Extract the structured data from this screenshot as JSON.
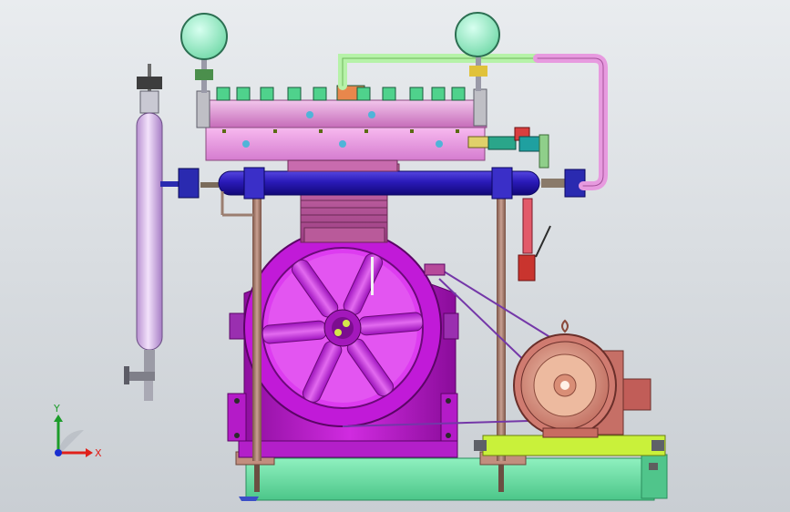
{
  "viewport": {
    "background_top": "#e9ecef",
    "background_bottom": "#c9ced3"
  },
  "triad": {
    "x_label": "X",
    "y_label": "Y",
    "x_color": "#e0201a",
    "y_color": "#1c9c2a",
    "z_color": "#1a2fd0"
  },
  "colors": {
    "base_plate": "#6fe0a6",
    "flywheel": "#d31ee8",
    "crankcase": "#c51fd6",
    "cylinder_head": "#e49ad6",
    "manifold": "#2a1ab8",
    "receiver": "#e6c7f2",
    "gauge": "#9af0c9",
    "motor": "#cf7a7a",
    "motor_face": "#e8b29a",
    "pipe_green": "#b6f2a8",
    "pipe_pink": "#e79adf",
    "rod": "#a87a6a",
    "motor_frame": "#c9f13a"
  },
  "components": [
    "pressure-gauge-left",
    "pressure-gauge-right",
    "cylinder-head",
    "intake-manifold",
    "gas-receiver",
    "flywheel",
    "crankcase",
    "electric-motor",
    "base-plate",
    "drive-belt"
  ]
}
